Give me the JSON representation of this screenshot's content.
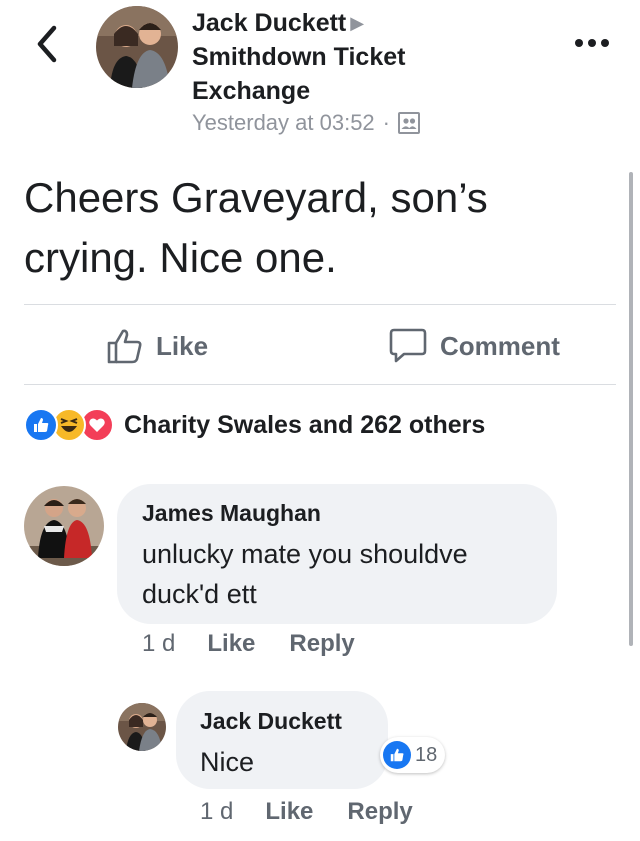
{
  "post": {
    "author": "Jack Duckett",
    "group": "Smithdown Ticket Exchange",
    "timestamp": "Yesterday at 03:52",
    "separator": "·",
    "privacy_icon": "group-members-icon",
    "text": "Cheers Graveyard, son’s crying. Nice one."
  },
  "actions": {
    "like_label": "Like",
    "comment_label": "Comment"
  },
  "reactions": {
    "icons": [
      "like-reaction-icon",
      "haha-reaction-icon",
      "love-reaction-icon"
    ],
    "summary": "Charity Swales and 262 others"
  },
  "comments": [
    {
      "author": "James Maughan",
      "text": "unlucky mate you shouldve duck'd ett",
      "time": "1 d",
      "like_label": "Like",
      "reply_label": "Reply"
    },
    {
      "author": "Jack Duckett",
      "text": "Nice",
      "time": "1 d",
      "like_label": "Like",
      "reply_label": "Reply",
      "reaction_count": "18"
    }
  ],
  "colors": {
    "text": "#1c1e21",
    "muted": "#606770",
    "meta": "#90949c",
    "bubble": "#f0f2f5",
    "like_blue": "#1877f2",
    "haha_yellow": "#f7b928",
    "love_red": "#f33e58"
  }
}
